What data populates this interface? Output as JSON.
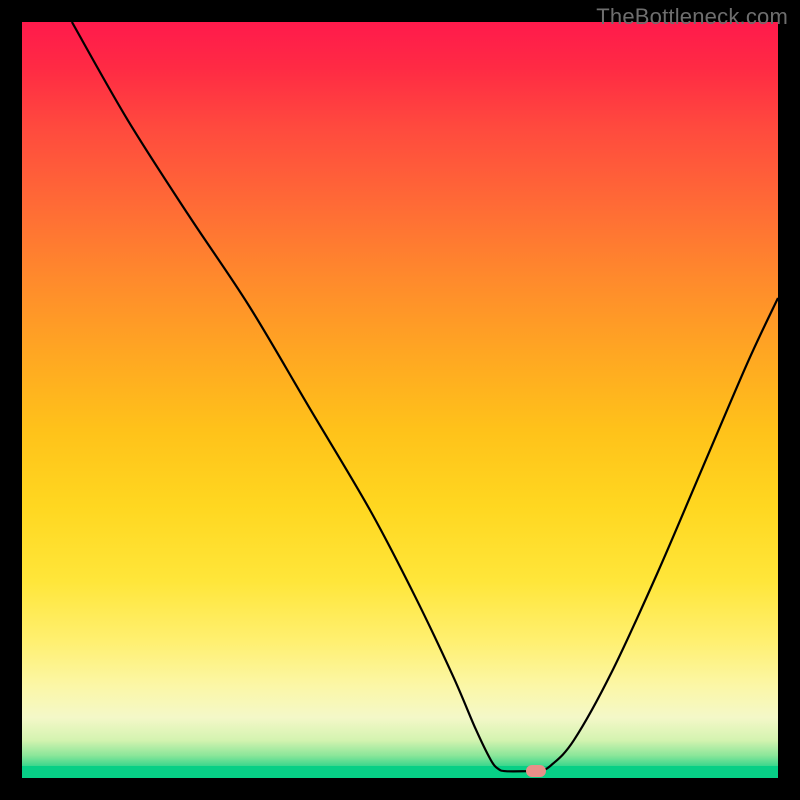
{
  "watermark": "TheBottleneck.com",
  "chart_data": {
    "type": "line",
    "title": "",
    "xlabel": "",
    "ylabel": "",
    "xlim": [
      0,
      100
    ],
    "ylim": [
      0,
      100
    ],
    "grid": false,
    "series": [
      {
        "name": "curve",
        "points": [
          {
            "x": 6.6,
            "y": 100.0
          },
          {
            "x": 14.0,
            "y": 87.0
          },
          {
            "x": 22.0,
            "y": 74.5
          },
          {
            "x": 30.0,
            "y": 62.5
          },
          {
            "x": 38.0,
            "y": 49.0
          },
          {
            "x": 46.0,
            "y": 35.5
          },
          {
            "x": 52.0,
            "y": 24.0
          },
          {
            "x": 57.0,
            "y": 13.5
          },
          {
            "x": 60.0,
            "y": 6.5
          },
          {
            "x": 62.0,
            "y": 2.4
          },
          {
            "x": 63.0,
            "y": 1.2
          },
          {
            "x": 64.0,
            "y": 0.9
          },
          {
            "x": 67.0,
            "y": 0.9
          },
          {
            "x": 68.4,
            "y": 0.9
          },
          {
            "x": 70.0,
            "y": 1.7
          },
          {
            "x": 73.0,
            "y": 5.0
          },
          {
            "x": 78.0,
            "y": 14.0
          },
          {
            "x": 84.0,
            "y": 27.0
          },
          {
            "x": 90.0,
            "y": 41.0
          },
          {
            "x": 96.0,
            "y": 55.0
          },
          {
            "x": 100.0,
            "y": 63.5
          }
        ]
      }
    ],
    "marker": {
      "x": 68.0,
      "y": 0.9,
      "color": "#e98f89"
    },
    "background": {
      "type": "vertical-gradient",
      "stops": [
        {
          "pos": 0.0,
          "color": "#ff1a4c"
        },
        {
          "pos": 0.5,
          "color": "#ffb71e"
        },
        {
          "pos": 0.85,
          "color": "#fff071"
        },
        {
          "pos": 0.97,
          "color": "#8ce69a"
        },
        {
          "pos": 1.0,
          "color": "#07cf86"
        }
      ]
    }
  }
}
